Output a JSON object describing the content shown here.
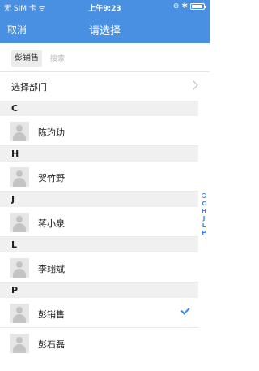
{
  "status": {
    "carrier": "无 SIM 卡 ᯤ",
    "time": "上午9:23",
    "icons": [
      "rotation-lock-icon",
      "bluetooth-icon",
      "battery-icon"
    ]
  },
  "nav": {
    "cancel": "取消",
    "title": "请选择"
  },
  "search": {
    "selected_chip": "彭销售",
    "placeholder": "搜索"
  },
  "department": {
    "label": "选择部门"
  },
  "sections": [
    {
      "letter": "C",
      "people": [
        {
          "name": "陈玓玏",
          "selected": false
        }
      ]
    },
    {
      "letter": "H",
      "people": [
        {
          "name": "贺竹野",
          "selected": false
        }
      ]
    },
    {
      "letter": "J",
      "people": [
        {
          "name": "蒋小泉",
          "selected": false
        }
      ]
    },
    {
      "letter": "L",
      "people": [
        {
          "name": "李翊斌",
          "selected": false
        }
      ]
    },
    {
      "letter": "P",
      "people": [
        {
          "name": "彭销售",
          "selected": true
        },
        {
          "name": "彭石磊",
          "selected": false
        }
      ]
    }
  ],
  "index_letters": [
    "C",
    "H",
    "J",
    "L",
    "P"
  ],
  "colors": {
    "accent": "#4a90e2",
    "check": "#3a86e0",
    "section_bg": "#f0f0f0"
  }
}
